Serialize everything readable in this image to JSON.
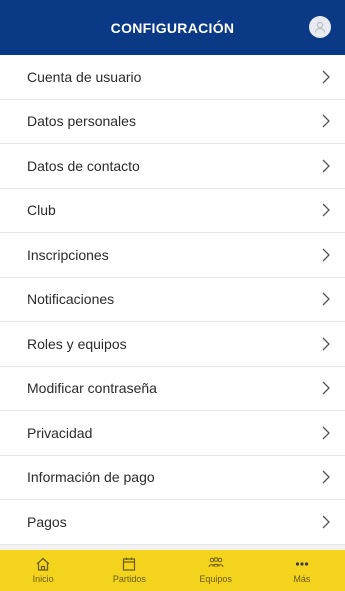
{
  "header": {
    "title": "CONFIGURACIÓN",
    "avatar_icon": "user-avatar-icon"
  },
  "menu": {
    "items": [
      {
        "label": "Cuenta de usuario"
      },
      {
        "label": "Datos personales"
      },
      {
        "label": "Datos de contacto"
      },
      {
        "label": "Club"
      },
      {
        "label": "Inscripciones"
      },
      {
        "label": "Notificaciones"
      },
      {
        "label": "Roles y equipos"
      },
      {
        "label": "Modificar contraseña"
      },
      {
        "label": "Privacidad"
      },
      {
        "label": "Información de pago"
      },
      {
        "label": "Pagos"
      }
    ]
  },
  "tabbar": {
    "tabs": [
      {
        "label": "Inicio",
        "icon": "home-icon"
      },
      {
        "label": "Partidos",
        "icon": "calendar-icon"
      },
      {
        "label": "Equipos",
        "icon": "team-icon"
      },
      {
        "label": "Más",
        "icon": "more-icon"
      }
    ]
  },
  "colors": {
    "header": "#0a3a86",
    "tabbar": "#f4d31c"
  }
}
